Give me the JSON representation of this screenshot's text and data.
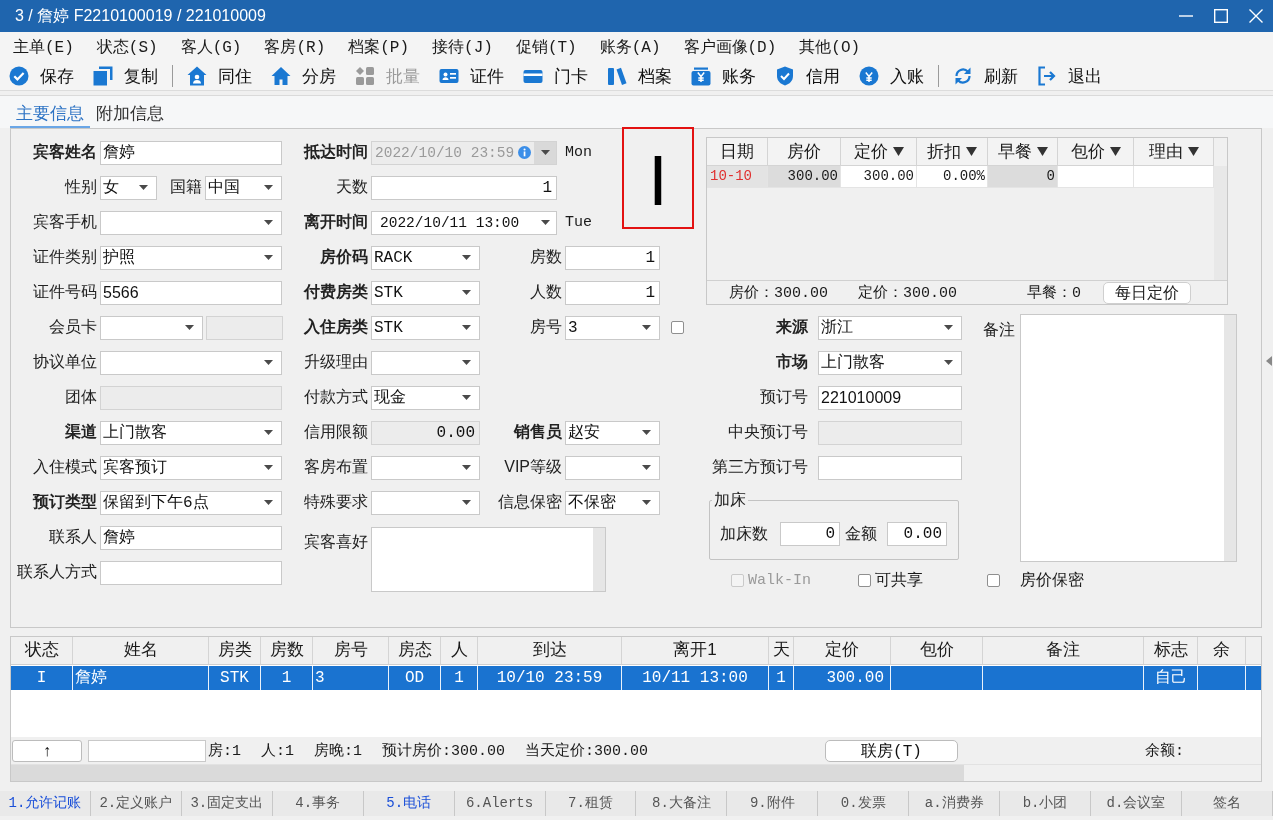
{
  "window": {
    "title": "3 / 詹婷 F2210100019 / 221010009"
  },
  "menu": [
    "主单(E)",
    "状态(S)",
    "客人(G)",
    "客房(R)",
    "档案(P)",
    "接待(J)",
    "促销(T)",
    "账务(A)",
    "客户画像(D)",
    "其他(O)"
  ],
  "toolbar": [
    {
      "items": [
        {
          "label": "保存",
          "disabled": false
        },
        {
          "label": "复制",
          "disabled": false
        }
      ]
    },
    {
      "items": [
        {
          "label": "同住",
          "disabled": false
        },
        {
          "label": "分房",
          "disabled": false
        },
        {
          "label": "批量",
          "disabled": true
        },
        {
          "label": "证件",
          "disabled": false
        },
        {
          "label": "门卡",
          "disabled": false
        },
        {
          "label": "档案",
          "disabled": false
        },
        {
          "label": "账务",
          "disabled": false
        },
        {
          "label": "信用",
          "disabled": false
        },
        {
          "label": "入账",
          "disabled": false
        }
      ]
    },
    {
      "items": [
        {
          "label": "刷新",
          "disabled": false
        },
        {
          "label": "退出",
          "disabled": false
        }
      ]
    }
  ],
  "tabs": [
    {
      "label": "主要信息",
      "selected": true
    },
    {
      "label": "附加信息",
      "selected": false
    }
  ],
  "form": {
    "left_rows": [
      [
        {
          "label": "宾客姓名",
          "bold": true,
          "kind": "text",
          "value": "詹婷",
          "disabled": false
        }
      ],
      [
        {
          "label": "性别",
          "bold": false,
          "kind": "select",
          "value": "女",
          "disabled": false
        },
        {
          "label": "国籍",
          "bold": false,
          "kind": "select",
          "value": "中国",
          "disabled": false
        }
      ],
      [
        {
          "label": "宾客手机",
          "bold": false,
          "kind": "select",
          "disabled": false
        }
      ],
      [
        {
          "label": "证件类别",
          "bold": false,
          "kind": "select",
          "value": "护照",
          "disabled": false
        }
      ],
      [
        {
          "label": "证件号码",
          "bold": false,
          "kind": "text",
          "value": "5566",
          "disabled": false
        }
      ],
      [
        {
          "label": "会员卡",
          "bold": false,
          "kind": "select",
          "disabled": false
        },
        {
          "kind": "text",
          "disabled": true
        }
      ],
      [
        {
          "label": "协议单位",
          "bold": false,
          "kind": "select",
          "disabled": false
        }
      ],
      [
        {
          "label": "团体",
          "bold": false,
          "kind": "text",
          "disabled": true
        }
      ],
      [
        {
          "label": "渠道",
          "bold": true,
          "kind": "select",
          "value": "上门散客",
          "disabled": false
        }
      ],
      [
        {
          "label": "入住模式",
          "bold": false,
          "kind": "select",
          "value": "宾客预订",
          "disabled": false
        }
      ],
      [
        {
          "label": "预订类型",
          "bold": true,
          "kind": "select",
          "value": "保留到下午6点",
          "disabled": false
        }
      ],
      [
        {
          "label": "联系人",
          "bold": false,
          "kind": "text",
          "value": "詹婷",
          "disabled": false
        }
      ],
      [
        {
          "label": "联系人方式",
          "bold": false,
          "kind": "text",
          "disabled": false
        }
      ]
    ],
    "middle_rows": [
      [
        {
          "label": "抵达时间",
          "bold": true,
          "kind": "datetime",
          "value": "2022/10/10 23:59",
          "disabled": true,
          "info": true,
          "note": "Mon"
        }
      ],
      [
        {
          "label": "天数",
          "bold": false,
          "kind": "number",
          "value": "1",
          "disabled": false
        }
      ],
      [
        {
          "label": "离开时间",
          "bold": true,
          "kind": "datetime",
          "value": "2022/10/11 13:00",
          "disabled": false,
          "note": "Tue"
        }
      ],
      [
        {
          "label": "房价码",
          "bold": true,
          "kind": "select",
          "value": "RACK",
          "disabled": false
        },
        {
          "label": "房数",
          "bold": false,
          "kind": "number",
          "value": "1",
          "disabled": false
        }
      ],
      [
        {
          "label": "付费房类",
          "bold": true,
          "kind": "select",
          "value": "STK",
          "disabled": false
        },
        {
          "label": "人数",
          "bold": false,
          "kind": "number",
          "value": "1",
          "disabled": false
        }
      ],
      [
        {
          "label": "入住房类",
          "bold": true,
          "kind": "select",
          "value": "STK",
          "disabled": false
        },
        {
          "label": "房号",
          "bold": false,
          "kind": "select",
          "value": "3",
          "disabled": false
        },
        {
          "kind": "checkbox",
          "checked": false
        }
      ],
      [
        {
          "label": "升级理由",
          "bold": false,
          "kind": "select",
          "disabled": false
        }
      ],
      [
        {
          "label": "付款方式",
          "bold": false,
          "kind": "select",
          "value": "现金",
          "disabled": false
        }
      ],
      [
        {
          "label": "信用限额",
          "bold": false,
          "kind": "number",
          "value": "0.00",
          "disabled": true
        },
        {
          "label": "销售员",
          "bold": true,
          "kind": "select",
          "value": "赵安",
          "disabled": false
        }
      ],
      [
        {
          "label": "客房布置",
          "bold": false,
          "kind": "select",
          "disabled": false
        },
        {
          "label": "VIP等级",
          "bold": false,
          "kind": "select",
          "disabled": false
        }
      ],
      [
        {
          "label": "特殊要求",
          "bold": false,
          "kind": "select",
          "disabled": false
        },
        {
          "label": "信息保密",
          "bold": false,
          "kind": "select",
          "value": "不保密",
          "disabled": false
        }
      ],
      [
        {
          "label": "宾客喜好",
          "bold": false,
          "kind": "textarea",
          "disabled": false
        }
      ]
    ],
    "right_rows": [
      [
        {
          "label": "来源",
          "bold": true,
          "kind": "select",
          "value": "浙江",
          "disabled": false
        }
      ],
      [
        {
          "label": "市场",
          "bold": true,
          "kind": "select",
          "value": "上门散客",
          "disabled": false
        }
      ],
      [
        {
          "label": "预订号",
          "bold": false,
          "kind": "text",
          "value": "221010009",
          "disabled": false
        }
      ],
      [
        {
          "label": "中央预订号",
          "bold": false,
          "kind": "text",
          "disabled": true
        }
      ],
      [
        {
          "label": "第三方预订号",
          "bold": false,
          "kind": "text",
          "disabled": false
        }
      ]
    ]
  },
  "status_marker": {
    "text": "I"
  },
  "rate_grid": {
    "columns": [
      {
        "label": "日期",
        "filter": false,
        "editable": false
      },
      {
        "label": "房价",
        "filter": false,
        "editable": false
      },
      {
        "label": "定价",
        "filter": true,
        "editable": true
      },
      {
        "label": "折扣",
        "filter": true,
        "editable": true
      },
      {
        "label": "早餐",
        "filter": true,
        "editable": false
      },
      {
        "label": "包价",
        "filter": true,
        "editable": true
      },
      {
        "label": "理由",
        "filter": true,
        "editable": true
      }
    ],
    "rows": [
      {
        "cells": [
          "10-10",
          "300.00",
          "300.00",
          "0.00%",
          "0",
          null,
          null
        ]
      }
    ],
    "summary": [
      "房价：300.00",
      "定价：300.00",
      "早餐：0"
    ],
    "button": "每日定价"
  },
  "extra_bed": {
    "title": "加床",
    "fields": [
      {
        "label": "加床数",
        "value": "0"
      },
      {
        "label": "金额",
        "value": "0.00"
      }
    ]
  },
  "remarks": {
    "label": "备注"
  },
  "options": [
    {
      "label": "Walk-In",
      "checked": false,
      "disabled": true
    },
    {
      "label": "可共享",
      "checked": false,
      "disabled": false
    },
    {
      "label": "房价保密",
      "checked": false,
      "disabled": false
    }
  ],
  "guest_table": {
    "columns": [
      "状态",
      "姓名",
      "房类",
      "房数",
      "房号",
      "房态",
      "人",
      "到达",
      "离开1",
      "天",
      "定价",
      "包价",
      "备注",
      "标志",
      "余"
    ],
    "rows": [
      {
        "selected": true,
        "cells": [
          "I",
          "詹婷",
          "STK",
          "1",
          "3",
          "OD",
          "1",
          "10/10 23:59",
          "10/11 13:00",
          "1",
          "300.00",
          null,
          null,
          "自己",
          null
        ]
      }
    ],
    "footer": {
      "up_button": "↑",
      "stats": [
        "房:1",
        "人:1",
        "房晚:1",
        "预计房价:300.00",
        "当天定价:300.00"
      ],
      "link_button": "联房(T)",
      "balance_label": "余额:"
    }
  },
  "bottom_tabs": [
    {
      "label": "1.允许记账",
      "highlighted": true
    },
    {
      "label": "2.定义账户",
      "highlighted": false
    },
    {
      "label": "3.固定支出",
      "highlighted": false
    },
    {
      "label": "4.事务",
      "highlighted": false
    },
    {
      "label": "5.电话",
      "highlighted": true
    },
    {
      "label": "6.Alerts",
      "highlighted": false
    },
    {
      "label": "7.租赁",
      "highlighted": false
    },
    {
      "label": "8.大备注",
      "highlighted": false
    },
    {
      "label": "9.附件",
      "highlighted": false
    },
    {
      "label": "0.发票",
      "highlighted": false
    },
    {
      "label": "a.消费券",
      "highlighted": false
    },
    {
      "label": "b.小团",
      "highlighted": false
    },
    {
      "label": "d.会议室",
      "highlighted": false
    },
    {
      "label": "签名",
      "highlighted": false
    }
  ]
}
